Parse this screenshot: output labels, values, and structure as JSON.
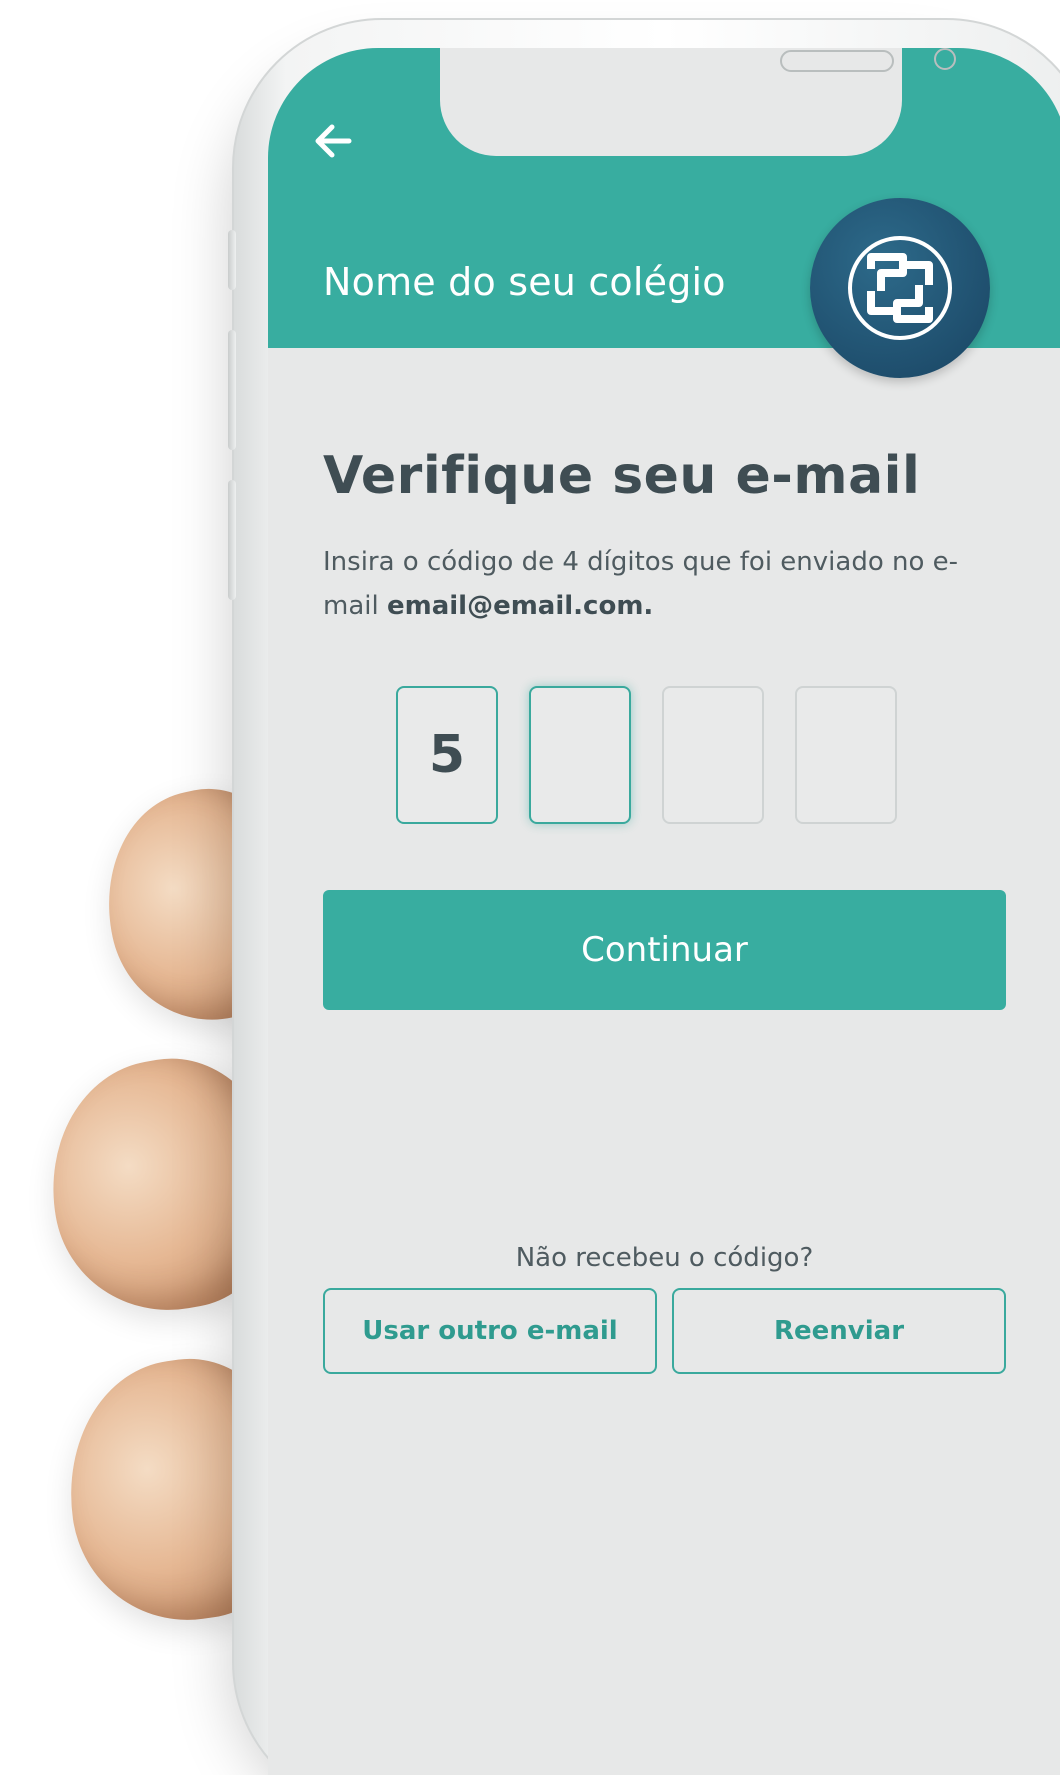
{
  "header": {
    "school_name": "Nome do seu colégio"
  },
  "main": {
    "title": "Verifique seu e-mail",
    "description_prefix": "Insira o código de 4 dígitos que foi enviado no e-mail ",
    "email": "email@email.com.",
    "code_digits": [
      "5",
      "",
      "",
      ""
    ],
    "continue_label": "Continuar",
    "no_code_text": "Não recebeu o código?",
    "use_other_email_label": "Usar outro e-mail",
    "resend_label": "Reenviar"
  },
  "colors": {
    "accent": "#38ada0",
    "text_dark": "#3f4d53",
    "screen_bg": "#e7e8e8",
    "logo_bg": "#1f4f6e"
  },
  "icons": {
    "back": "arrow-left-icon",
    "logo": "school-logo-icon"
  }
}
